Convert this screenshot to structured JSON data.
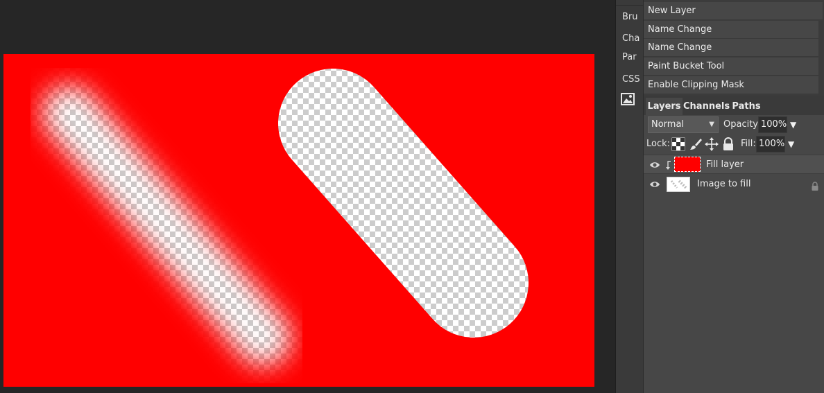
{
  "dock": {
    "items": [
      {
        "label": "Bru"
      },
      {
        "label": "Cha"
      },
      {
        "label": "Par"
      },
      {
        "label": "CSS"
      }
    ],
    "image_icon": "image-icon"
  },
  "history": {
    "items": [
      {
        "label": "New Layer"
      },
      {
        "label": "Name Change"
      },
      {
        "label": "Name Change"
      },
      {
        "label": "Paint Bucket Tool"
      },
      {
        "label": "Enable Clipping Mask"
      }
    ]
  },
  "tabs": [
    {
      "label": "Layers",
      "active": true
    },
    {
      "label": "Channels",
      "active": false
    },
    {
      "label": "Paths",
      "active": false
    }
  ],
  "blend_mode": {
    "value": "Normal"
  },
  "opacity": {
    "label": "Opacity:",
    "value": "100%"
  },
  "lock": {
    "label": "Lock:",
    "icons": [
      "transparency-lock-icon",
      "brush-lock-icon",
      "move-lock-icon",
      "padlock-icon"
    ]
  },
  "fill": {
    "label": "Fill:",
    "value": "100%"
  },
  "layers": [
    {
      "name": "Fill layer",
      "selected": true,
      "clipped": true,
      "thumb_color": "#ff0000"
    },
    {
      "name": "Image to fill",
      "selected": false,
      "locked": true
    }
  ],
  "colors": {
    "canvas_fill": "#ff0000",
    "workspace_bg": "#262626",
    "panel_bg": "#474747"
  }
}
